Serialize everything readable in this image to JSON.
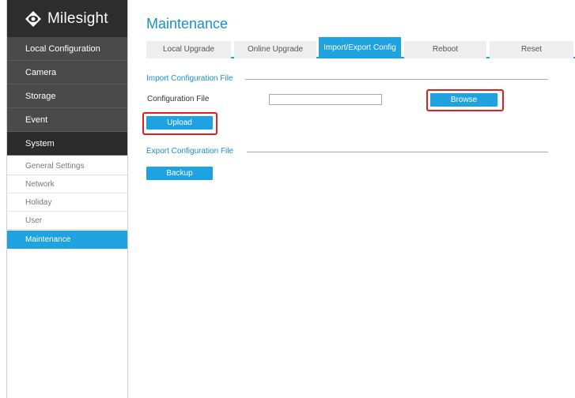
{
  "app": {
    "logo_text": "Milesight",
    "logo_icon": "eye-logo-icon"
  },
  "sidebar": {
    "menu": [
      {
        "label": "Local Configuration"
      },
      {
        "label": "Camera"
      },
      {
        "label": "Storage"
      },
      {
        "label": "Event"
      },
      {
        "label": "System"
      }
    ],
    "system_items": [
      {
        "label": "General Settings"
      },
      {
        "label": "Network"
      },
      {
        "label": "Holiday"
      },
      {
        "label": "User"
      },
      {
        "label": "Maintenance"
      }
    ]
  },
  "main": {
    "title": "Maintenance",
    "tabs": [
      {
        "label": "Local Upgrade"
      },
      {
        "label": "Online Upgrade"
      },
      {
        "label": "Import/Export Config"
      },
      {
        "label": "Reboot"
      },
      {
        "label": "Reset"
      }
    ],
    "import_section": {
      "title": "Import Configuration File",
      "field_label": "Configuration File",
      "file_value": "",
      "browse_label": "Browse",
      "upload_label": "Upload"
    },
    "export_section": {
      "title": "Export Configuration File",
      "backup_label": "Backup"
    }
  },
  "colors": {
    "accent": "#1fa3e0",
    "title": "#1b8fd0",
    "highlight": "#e02020",
    "sidebar_dark": "#4a4a4a"
  }
}
